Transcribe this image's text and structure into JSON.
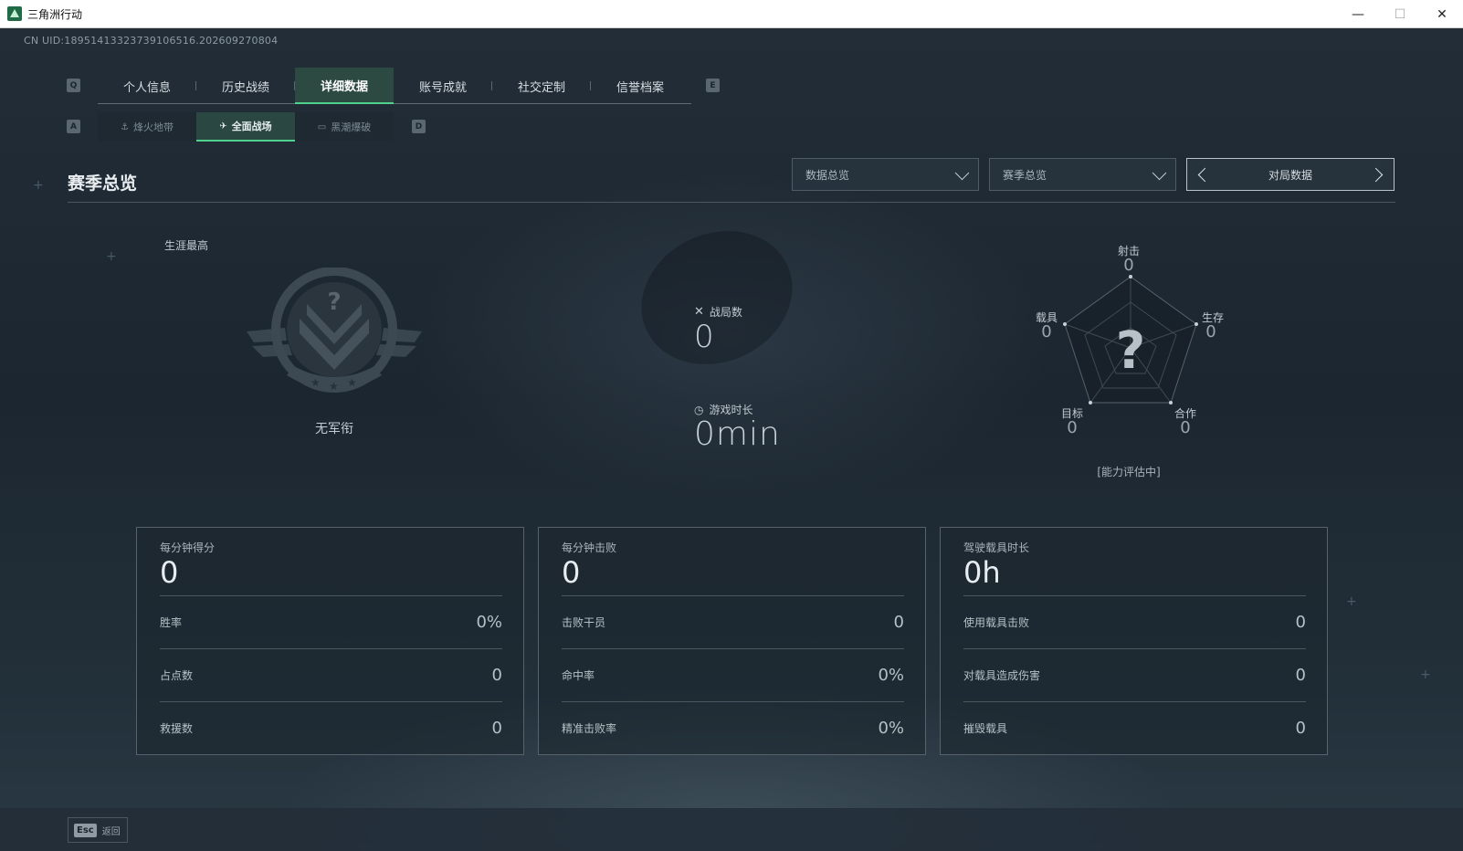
{
  "window": {
    "title": "三角洲行动",
    "minimize": "—",
    "maximize": "☐",
    "close": "✕"
  },
  "uid": "CN UID:18951413323739106516.202609270804",
  "nav": {
    "prev_key": "Q",
    "next_key": "E",
    "tabs": [
      {
        "label": "个人信息"
      },
      {
        "label": "历史战绩"
      },
      {
        "label": "详细数据"
      },
      {
        "label": "账号成就"
      },
      {
        "label": "社交定制"
      },
      {
        "label": "信誉档案"
      }
    ],
    "active_tab": 2
  },
  "subnav": {
    "prev_key": "A",
    "next_key": "D",
    "tabs": [
      {
        "label": "烽火地带",
        "icon": "⚓"
      },
      {
        "label": "全面战场",
        "icon": "✈"
      },
      {
        "label": "黑潮爆破",
        "icon": "▭"
      }
    ],
    "active_tab": 1
  },
  "section": {
    "title": "赛季总览",
    "dropdown1": "数据总览",
    "dropdown2": "赛季总览",
    "pager_label": "对局数据"
  },
  "career": {
    "label": "生涯最高",
    "rank_name": "无军衔",
    "emblem_mark": "?"
  },
  "center": {
    "matches_label": "战局数",
    "matches_value": "0",
    "playtime_label": "游戏时长",
    "playtime_value": "0min"
  },
  "radar": {
    "center_mark": "?",
    "status": "[能力评估中]",
    "axes": [
      {
        "label": "射击",
        "value": "0"
      },
      {
        "label": "生存",
        "value": "0"
      },
      {
        "label": "合作",
        "value": "0"
      },
      {
        "label": "目标",
        "value": "0"
      },
      {
        "label": "载具",
        "value": "0"
      }
    ]
  },
  "cards": [
    {
      "head_label": "每分钟得分",
      "head_value": "0",
      "rows": [
        {
          "label": "胜率",
          "value": "0%"
        },
        {
          "label": "占点数",
          "value": "0"
        },
        {
          "label": "救援数",
          "value": "0"
        }
      ]
    },
    {
      "head_label": "每分钟击败",
      "head_value": "0",
      "rows": [
        {
          "label": "击败干员",
          "value": "0"
        },
        {
          "label": "命中率",
          "value": "0%"
        },
        {
          "label": "精准击败率",
          "value": "0%"
        }
      ]
    },
    {
      "head_label": "驾驶载具时长",
      "head_value": "0h",
      "rows": [
        {
          "label": "使用载具击败",
          "value": "0"
        },
        {
          "label": "对载具造成伤害",
          "value": "0"
        },
        {
          "label": "摧毁载具",
          "value": "0"
        }
      ]
    }
  ],
  "footer": {
    "esc_key": "Esc",
    "back_label": "返回"
  },
  "colors": {
    "accent": "#4fd18e",
    "active_tab_bg": "#2d4a42"
  }
}
